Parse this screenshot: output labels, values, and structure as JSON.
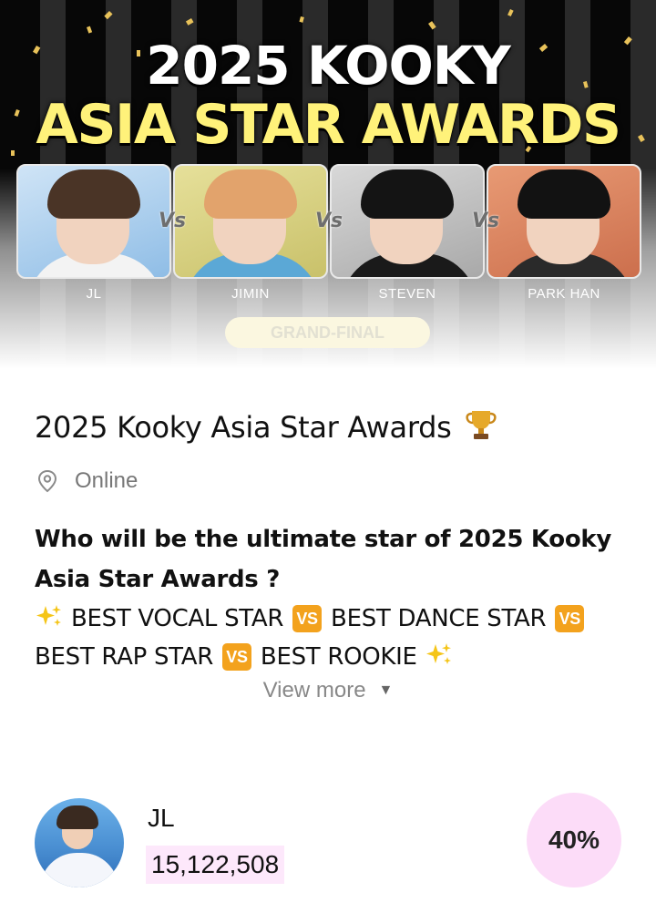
{
  "banner": {
    "title_line1": "2025 KOOKY",
    "title_line2": "ASIA STAR AWARDS",
    "vs_label": "Vs",
    "candidates": [
      "JL",
      "JIMIN",
      "STEVEN",
      "PARK HAN"
    ],
    "stage_badge": "GRAND-FINAL",
    "colors": {
      "title_yellow": "#fff27a",
      "title_white": "#ffffff"
    }
  },
  "event": {
    "title": "2025 Kooky Asia Star Awards",
    "title_icon": "trophy-icon",
    "location_icon": "location-pin-icon",
    "location": "Online",
    "question": "Who will be the ultimate star of 2025 Kooky Asia Star Awards ?",
    "categories": [
      "BEST VOCAL STAR",
      "BEST DANCE STAR",
      "BEST RAP STAR",
      "BEST ROOKIE"
    ],
    "vs_badge": "VS",
    "sparkle_icon": "sparkles-icon",
    "view_more": "View more",
    "view_more_icon": "caret-down-icon"
  },
  "candidate": {
    "name": "JL",
    "votes": "15,122,508",
    "percent": "40%",
    "colors": {
      "highlight": "#fde8fb",
      "percent_bg": "#fcdcf8",
      "vs_badge": "#f3a21d"
    }
  }
}
